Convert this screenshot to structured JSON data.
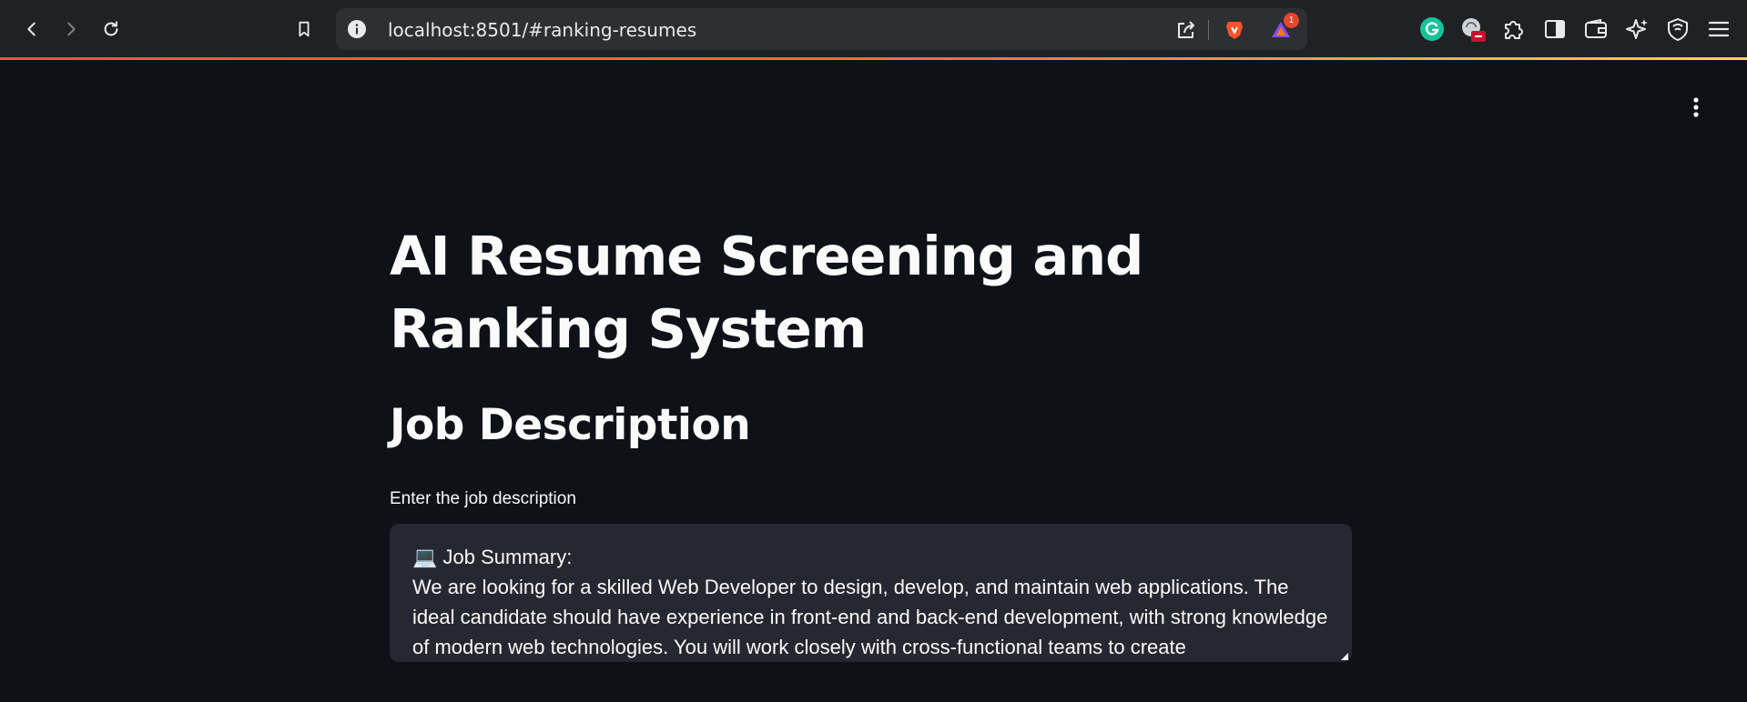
{
  "browser": {
    "url": "localhost:8501/#ranking-resumes",
    "notification_count": "1",
    "toolbar_icons": [
      "back-icon",
      "forward-icon",
      "reload-icon",
      "bookmark-icon",
      "site-info-icon",
      "share-icon",
      "brave-shields-icon",
      "brave-rewards-icon",
      "grammarly-icon",
      "extension-badge-icon",
      "extensions-icon",
      "sidebar-icon",
      "wallet-icon",
      "leo-ai-icon",
      "vpn-icon",
      "menu-icon"
    ]
  },
  "app": {
    "title": "AI Resume Screening and Ranking System",
    "section_header": "Job Description",
    "input_label": "Enter the job description",
    "textarea": {
      "emoji": "💻",
      "summary_heading": "Job Summary:",
      "body": "We are looking for a skilled Web Developer to design, develop, and maintain web applications. The ideal candidate should have experience in front-end and back-end development, with strong knowledge of modern web technologies. You will work closely with cross-functional teams to create"
    }
  },
  "colors": {
    "app_background": "#0e1117",
    "textarea_background": "#262730",
    "chrome_background": "#202124",
    "accent_bar": "#ff4b4b"
  }
}
